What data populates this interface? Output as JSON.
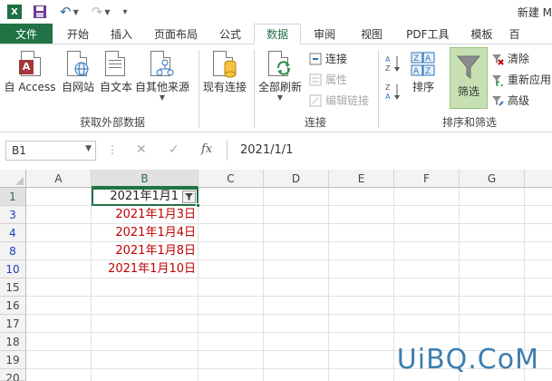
{
  "window": {
    "title": "新建 M"
  },
  "quick_access": {
    "logo_letter": "X"
  },
  "tabs": [
    {
      "label": "文件"
    },
    {
      "label": "开始"
    },
    {
      "label": "插入"
    },
    {
      "label": "页面布局"
    },
    {
      "label": "公式"
    },
    {
      "label": "数据"
    },
    {
      "label": "审阅"
    },
    {
      "label": "视图"
    },
    {
      "label": "PDF工具"
    },
    {
      "label": "模板"
    },
    {
      "label": "百"
    }
  ],
  "ribbon": {
    "external": {
      "group_label": "获取外部数据",
      "buttons": [
        {
          "label": "自 Access",
          "icon": "access-icon"
        },
        {
          "label": "自网站",
          "icon": "web-icon"
        },
        {
          "label": "自文本",
          "icon": "text-file-icon"
        },
        {
          "label": "自其他来源",
          "icon": "other-sources-icon"
        }
      ],
      "existing_label": "现有连接"
    },
    "connections": {
      "group_label": "连接",
      "refresh_label": "全部刷新",
      "connections_label": "连接",
      "properties_label": "属性",
      "edit_links_label": "编辑链接"
    },
    "sort_filter": {
      "group_label": "排序和筛选",
      "sort_label": "排序",
      "filter_label": "筛选",
      "clear_label": "清除",
      "reapply_label": "重新应用",
      "advanced_label": "高级"
    }
  },
  "formula_bar": {
    "name_box": "B1",
    "dots": "⋮",
    "fx": "fx",
    "value": "2021/1/1"
  },
  "grid": {
    "columns": [
      "A",
      "B",
      "C",
      "D",
      "E",
      "F",
      "G"
    ],
    "rows": [
      {
        "num": "1",
        "b": "2021年1月1",
        "filtered": false,
        "active": true
      },
      {
        "num": "3",
        "b": "2021年1月3日",
        "filtered": true
      },
      {
        "num": "4",
        "b": "2021年1月4日",
        "filtered": true
      },
      {
        "num": "8",
        "b": "2021年1月8日",
        "filtered": true
      },
      {
        "num": "10",
        "b": "2021年1月10日",
        "filtered": true
      },
      {
        "num": "15",
        "b": ""
      },
      {
        "num": "16",
        "b": ""
      },
      {
        "num": "17",
        "b": ""
      },
      {
        "num": "18",
        "b": ""
      },
      {
        "num": "19",
        "b": ""
      },
      {
        "num": "20",
        "b": ""
      }
    ]
  },
  "colors": {
    "excel_green": "#217346",
    "red_text": "#c00000",
    "filtered_row_blue": "#1f3fbf"
  },
  "watermark": "UiBQ.CoM"
}
